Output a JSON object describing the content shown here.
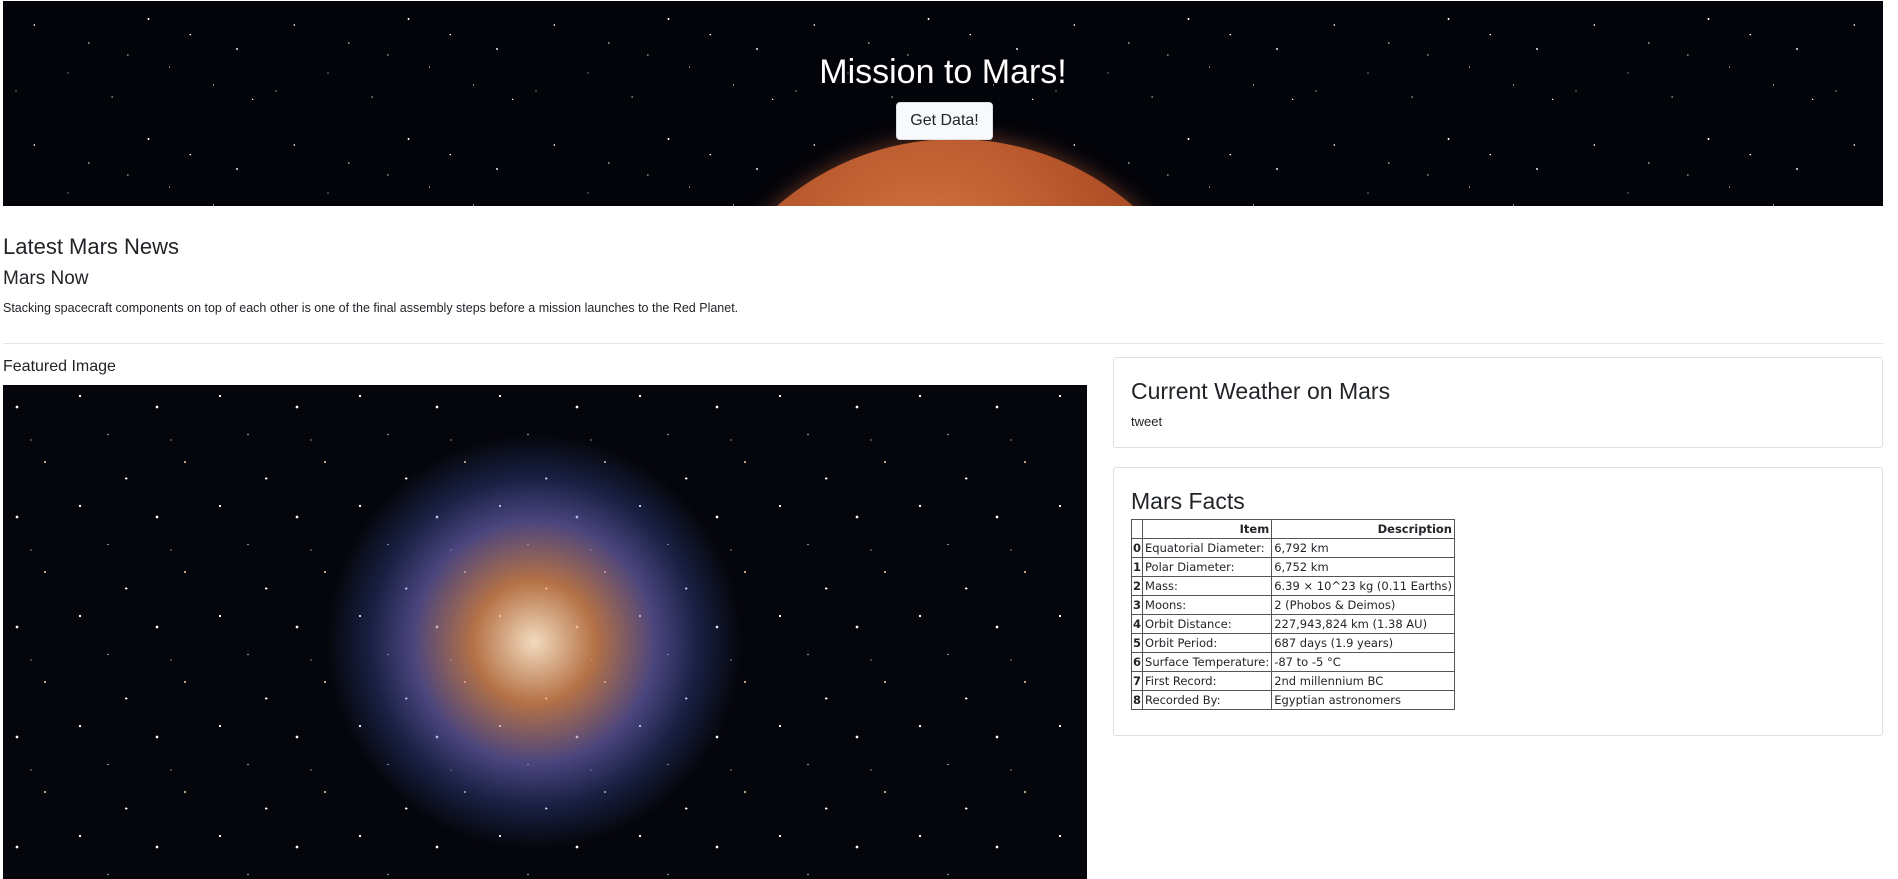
{
  "hero": {
    "title": "Mission to Mars!",
    "button_label": "Get Data!"
  },
  "news": {
    "heading": "Latest Mars News",
    "title": "Mars Now",
    "teaser": "Stacking spacecraft components on top of each other is one of the final assembly steps before a mission launches to the Red Planet."
  },
  "featured": {
    "heading": "Featured Image"
  },
  "weather": {
    "heading": "Current Weather on Mars",
    "text": "tweet"
  },
  "facts": {
    "heading": "Mars Facts",
    "columns": [
      "",
      "Item",
      "Description"
    ],
    "rows": [
      {
        "index": "0",
        "item": "Equatorial Diameter:",
        "description": "6,792 km"
      },
      {
        "index": "1",
        "item": "Polar Diameter:",
        "description": "6,752 km"
      },
      {
        "index": "2",
        "item": "Mass:",
        "description": "6.39 × 10^23 kg (0.11 Earths)"
      },
      {
        "index": "3",
        "item": "Moons:",
        "description": "2 (Phobos & Deimos)"
      },
      {
        "index": "4",
        "item": "Orbit Distance:",
        "description": "227,943,824 km (1.38 AU)"
      },
      {
        "index": "5",
        "item": "Orbit Period:",
        "description": "687 days (1.9 years)"
      },
      {
        "index": "6",
        "item": "Surface Temperature:",
        "description": "-87 to -5 °C"
      },
      {
        "index": "7",
        "item": "First Record:",
        "description": "2nd millennium BC"
      },
      {
        "index": "8",
        "item": "Recorded By:",
        "description": "Egyptian astronomers"
      }
    ]
  }
}
